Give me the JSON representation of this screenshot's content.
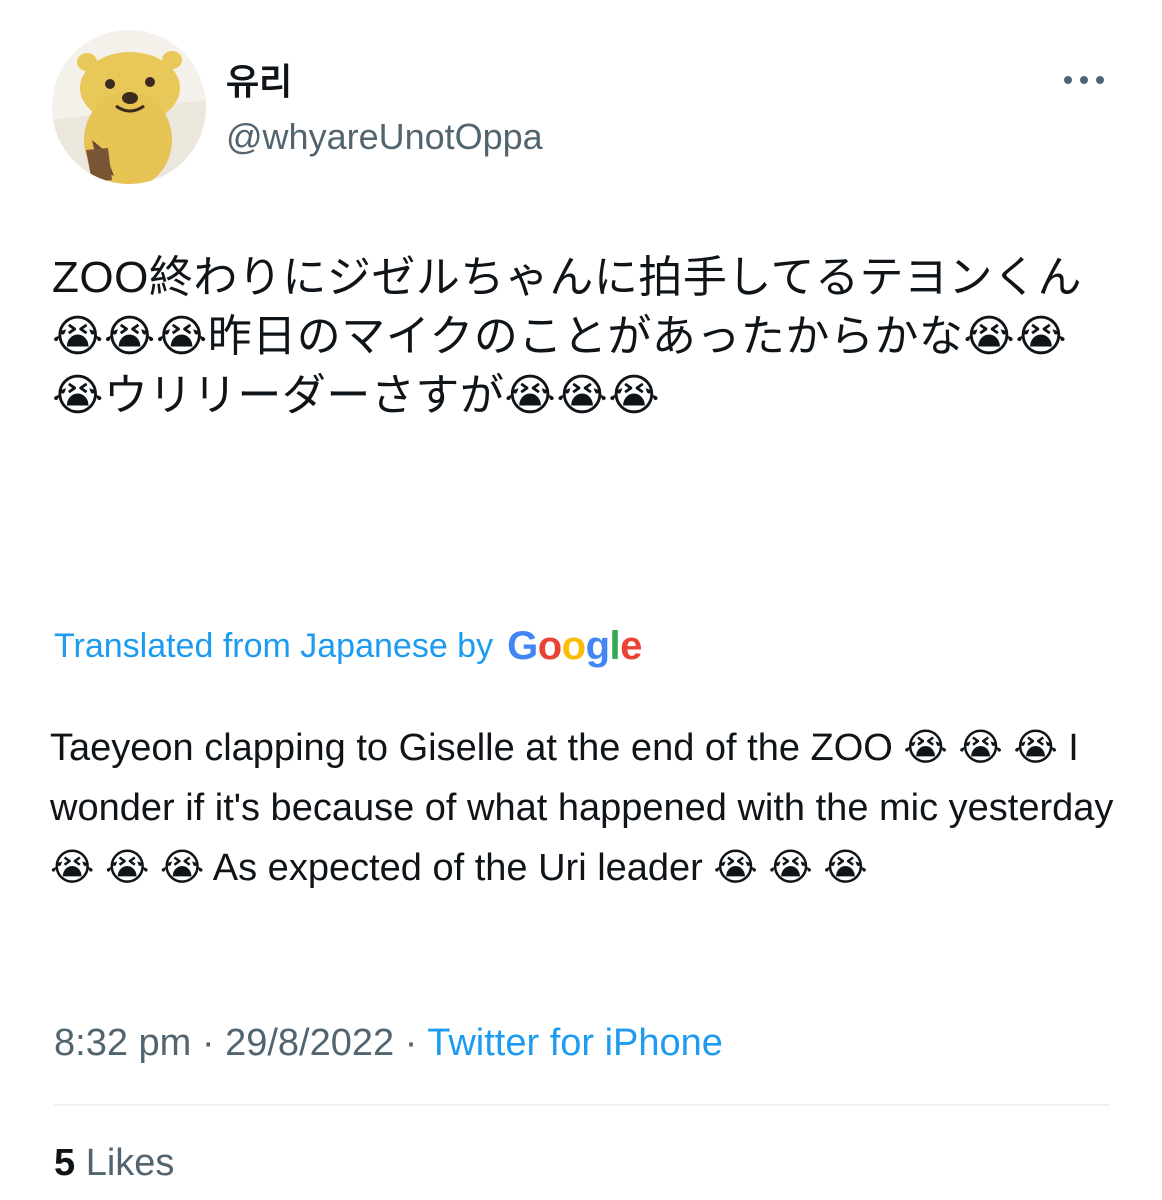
{
  "author": {
    "display_name": "유리",
    "handle": "@whyareUnotOppa"
  },
  "tweet": {
    "text": "ZOO終わりにジゼルちゃんに拍手してるテヨンくん😭😭😭昨日のマイクのことがあったからかな😭😭😭ウリリーダーさすが😭😭😭",
    "translation_label": "Translated from Japanese by",
    "translation_provider": "Google",
    "translated_text": "Taeyeon clapping to Giselle at the end of the ZOO 😭 😭 😭  I wonder if it's because of what happened with the mic yesterday 😭 😭 😭  As expected of the Uri leader 😭 😭 😭",
    "time": "8:32 pm",
    "date": "29/8/2022",
    "separator": " · ",
    "source": "Twitter for iPhone"
  },
  "stats": {
    "likes_count": "5",
    "likes_label": "Likes"
  },
  "icons": {
    "more": "more-horizontal-icon",
    "avatar": "otter-avatar"
  },
  "colors": {
    "link": "#1d9bf0",
    "secondary_text": "#536471",
    "primary_text": "#0f1419",
    "divider": "#eff3f4",
    "google_blue": "#4285F4",
    "google_red": "#EA4335",
    "google_yellow": "#FBBC05",
    "google_green": "#34A853"
  }
}
